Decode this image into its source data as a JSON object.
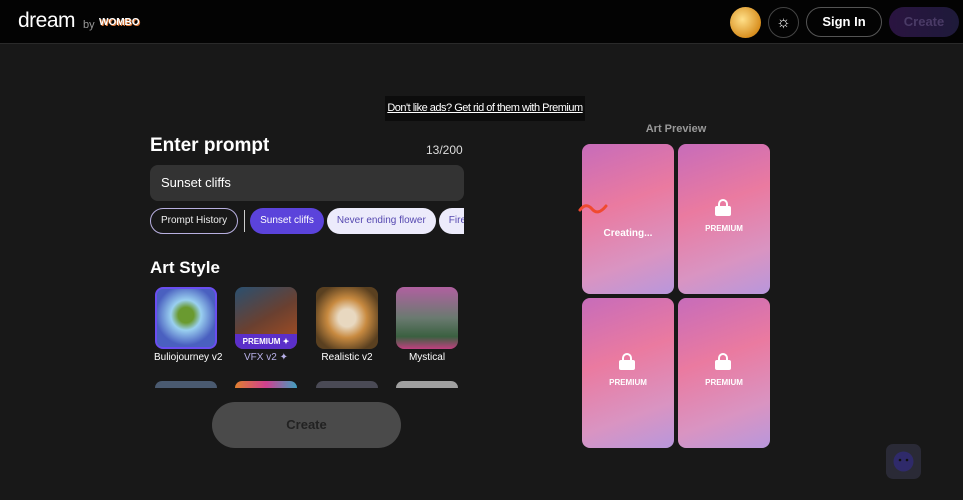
{
  "header": {
    "logo": "dream",
    "by": "by",
    "brand": "WOMBO",
    "sign_in": "Sign In",
    "create": "Create",
    "icons": [
      "avatar",
      "sun-icon"
    ]
  },
  "ad": {
    "text": "Don't like ads? Get rid of them with Premium"
  },
  "prompt": {
    "title": "Enter prompt",
    "count": "13/200",
    "value": "Sunset cliffs",
    "chips": [
      "Prompt History",
      "Sunset cliffs",
      "Never ending flower",
      "Fire and w"
    ]
  },
  "art_style": {
    "title": "Art Style",
    "items": [
      {
        "label": "Buliojourney v2"
      },
      {
        "label": "VFX v2 ✦",
        "badge": "PREMIUM ✦"
      },
      {
        "label": "Realistic v2"
      },
      {
        "label": "Mystical"
      }
    ]
  },
  "create_button": "Create",
  "preview": {
    "title": "Art Preview",
    "creating": "Creating...",
    "premium": "PREMIUM"
  },
  "colors": {
    "accent": "#5b43db",
    "premium": "#5b2fc9"
  }
}
